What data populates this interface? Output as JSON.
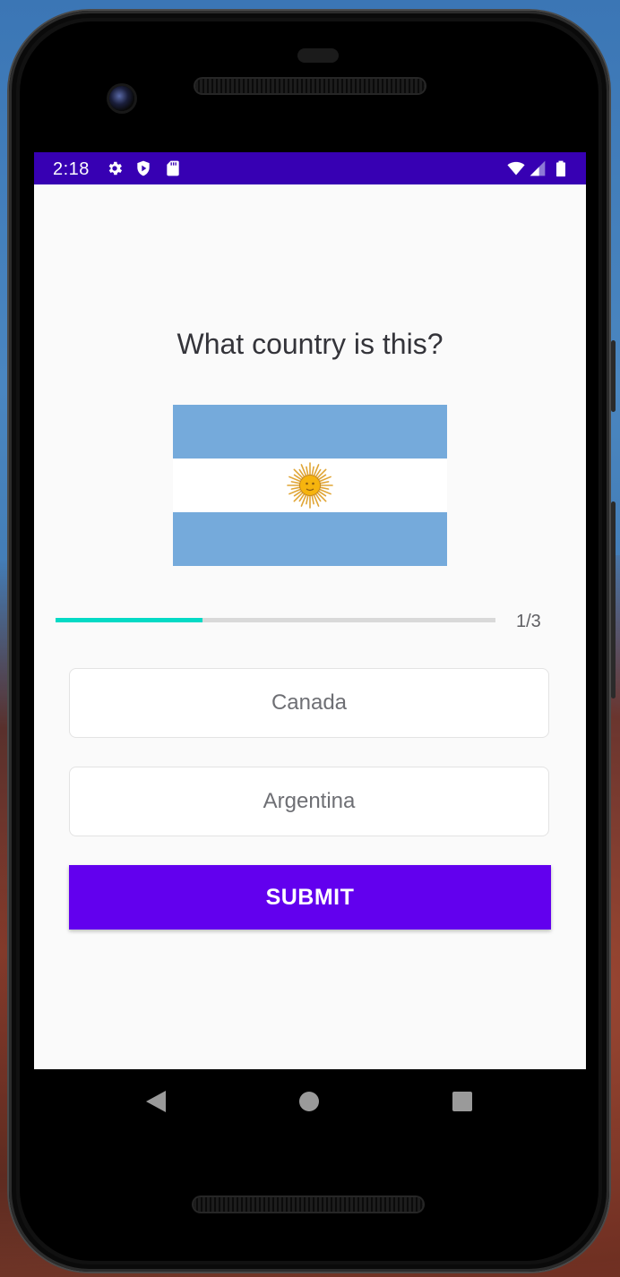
{
  "status_bar": {
    "time": "2:18",
    "icons": [
      "gear-icon",
      "shield-play-icon",
      "sd-card-icon",
      "wifi-icon",
      "signal-icon",
      "battery-icon"
    ],
    "background": "#3700b3"
  },
  "quiz": {
    "question": "What country is this?",
    "flag": {
      "icon": "argentina-flag",
      "colors": {
        "blue": "#75aadb",
        "white": "#ffffff",
        "sun": "#f6b40e"
      }
    },
    "progress": {
      "current": 1,
      "total": 3,
      "label": "1/3",
      "fraction": 0.333,
      "color": "#03dac5"
    },
    "options": [
      {
        "label": "Canada"
      },
      {
        "label": "Argentina"
      }
    ],
    "submit_label": "SUBMIT",
    "accent_color": "#6200ee"
  },
  "navigation_bar": {
    "icons": [
      "back-icon",
      "home-icon",
      "recents-icon"
    ]
  }
}
